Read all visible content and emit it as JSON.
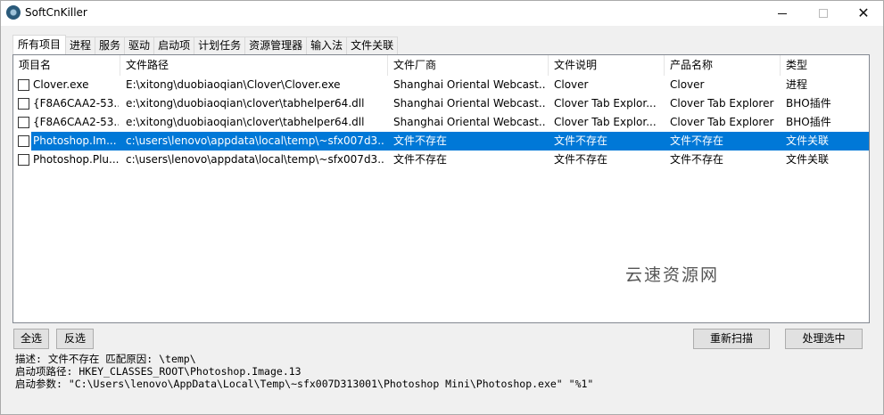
{
  "window": {
    "title": "SoftCnKiller",
    "minimize_glyph": "",
    "maximize_glyph": "",
    "close_glyph": "✕"
  },
  "tabs": [
    {
      "label": "所有项目",
      "active": true
    },
    {
      "label": "进程"
    },
    {
      "label": "服务"
    },
    {
      "label": "驱动"
    },
    {
      "label": "启动项"
    },
    {
      "label": "计划任务"
    },
    {
      "label": "资源管理器"
    },
    {
      "label": "输入法"
    },
    {
      "label": "文件关联"
    }
  ],
  "columns": [
    "项目名",
    "文件路径",
    "文件厂商",
    "文件说明",
    "产品名称",
    "类型"
  ],
  "rows": [
    {
      "name": "Clover.exe",
      "path": "E:\\xitong\\duobiaoqian\\Clover\\Clover.exe",
      "vendor": "Shanghai Oriental Webcast...",
      "desc": "Clover",
      "product": "Clover",
      "type": "进程",
      "checked": false,
      "selected": false
    },
    {
      "name": "{F8A6CAA2-53...",
      "path": "e:\\xitong\\duobiaoqian\\clover\\tabhelper64.dll",
      "vendor": "Shanghai Oriental Webcast...",
      "desc": "Clover Tab Explor...",
      "product": "Clover Tab Explorer",
      "type": "BHO插件",
      "checked": false,
      "selected": false
    },
    {
      "name": "{F8A6CAA2-53...",
      "path": "e:\\xitong\\duobiaoqian\\clover\\tabhelper64.dll",
      "vendor": "Shanghai Oriental Webcast...",
      "desc": "Clover Tab Explor...",
      "product": "Clover Tab Explorer",
      "type": "BHO插件",
      "checked": false,
      "selected": false
    },
    {
      "name": "Photoshop.Im...",
      "path": "c:\\users\\lenovo\\appdata\\local\\temp\\~sfx007d3...",
      "vendor": "文件不存在",
      "desc": "文件不存在",
      "product": "文件不存在",
      "type": "文件关联",
      "checked": false,
      "selected": true
    },
    {
      "name": "Photoshop.Plu...",
      "path": "c:\\users\\lenovo\\appdata\\local\\temp\\~sfx007d3...",
      "vendor": "文件不存在",
      "desc": "文件不存在",
      "product": "文件不存在",
      "type": "文件关联",
      "checked": false,
      "selected": false
    }
  ],
  "watermark": "云速资源网",
  "buttons": {
    "select_all": "全选",
    "invert": "反选",
    "rescan": "重新扫描",
    "process_selected": "处理选中"
  },
  "info": {
    "line1": "描述: 文件不存在  匹配原因: \\temp\\",
    "line2": "启动项路径: HKEY_CLASSES_ROOT\\Photoshop.Image.13",
    "line3": "启动参数: \"C:\\Users\\lenovo\\AppData\\Local\\Temp\\~sfx007D313001\\Photoshop Mini\\Photoshop.exe\" \"%1\""
  },
  "colors": {
    "selection": "#0078d7",
    "background": "#f0f0f0"
  }
}
